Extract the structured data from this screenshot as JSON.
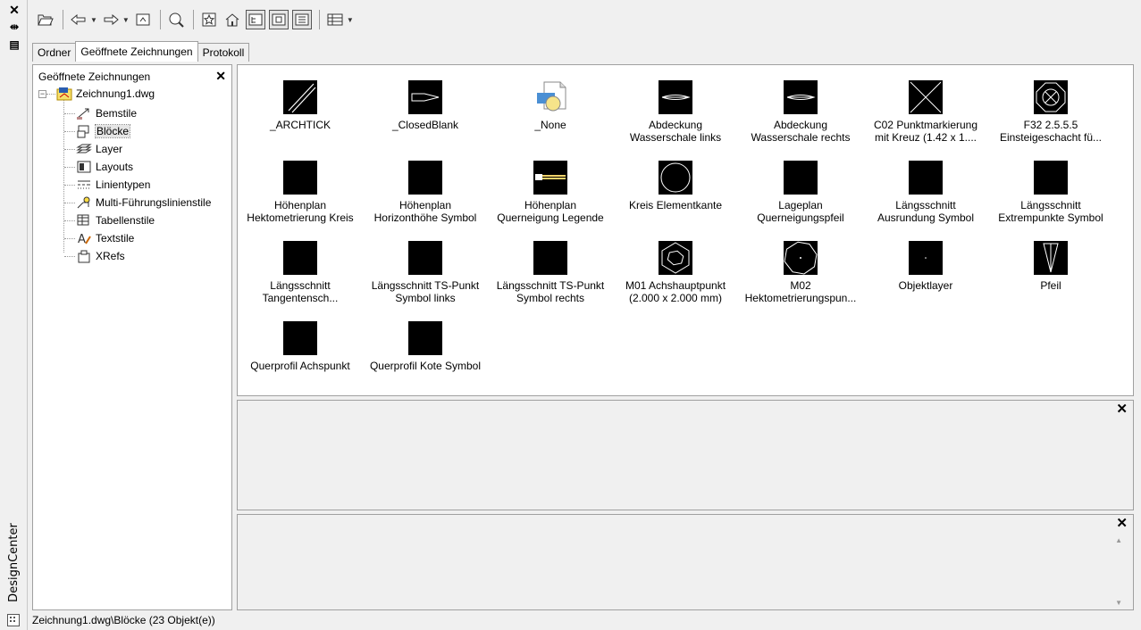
{
  "side": {
    "title": "DesignCenter",
    "close_glyph": "✕",
    "autohide_glyph": "⇹",
    "props_glyph": "▤"
  },
  "toolbar": {
    "icons": [
      "open-folder-icon",
      "back-icon",
      "forward-icon",
      "up-icon",
      "search-icon",
      "favorites-icon",
      "home-icon",
      "tree-view-toggle-icon",
      "preview-toggle-icon",
      "description-toggle-icon",
      "views-icon"
    ]
  },
  "tabs": [
    "Ordner",
    "Geöffnete Zeichnungen",
    "Protokoll"
  ],
  "active_tab": "Geöffnete Zeichnungen",
  "tree": {
    "header": "Geöffnete Zeichnungen",
    "close": "✕",
    "root": "Zeichnung1.dwg",
    "children": [
      "Bemstile",
      "Blöcke",
      "Layer",
      "Layouts",
      "Linientypen",
      "Multi-Führungslinienstile",
      "Tabellenstile",
      "Textstile",
      "XRefs"
    ],
    "selected": "Blöcke"
  },
  "blocks": [
    {
      "name": "_ARCHTICK",
      "thumb": "archtick"
    },
    {
      "name": "_ClosedBlank",
      "thumb": "closedblank"
    },
    {
      "name": "_None",
      "thumb": "none"
    },
    {
      "name": "Abdeckung\nWasserschale links",
      "thumb": "lens"
    },
    {
      "name": "Abdeckung\nWasserschale rechts",
      "thumb": "lens"
    },
    {
      "name": "C02 Punktmarkierung\nmit Kreuz (1.42 x 1....",
      "thumb": "cross"
    },
    {
      "name": "F32  2.5.5.5\nEinsteigeschacht fü...",
      "thumb": "octcross"
    },
    {
      "name": "Höhenplan\nHektometrierung Kreis",
      "thumb": "blank"
    },
    {
      "name": "Höhenplan\nHorizonthöhe Symbol",
      "thumb": "blank"
    },
    {
      "name": "Höhenplan\nQuerneigung Legende",
      "thumb": "legend"
    },
    {
      "name": "Kreis Elementkante",
      "thumb": "circle"
    },
    {
      "name": "Lageplan\nQuerneigungspfeil",
      "thumb": "blank"
    },
    {
      "name": "Längsschnitt\nAusrundung Symbol",
      "thumb": "blank"
    },
    {
      "name": "Längsschnitt\nExtrempunkte Symbol",
      "thumb": "blank"
    },
    {
      "name": "Längsschnitt\nTangentensch...",
      "thumb": "blank"
    },
    {
      "name": "Längsschnitt TS-Punkt\nSymbol links",
      "thumb": "blank"
    },
    {
      "name": "Längsschnitt TS-Punkt\nSymbol rechts",
      "thumb": "blank"
    },
    {
      "name": "M01 Achshauptpunkt\n(2.000 x 2.000 mm)",
      "thumb": "hexes"
    },
    {
      "name": "M02\nHektometrierungspun...",
      "thumb": "octagon"
    },
    {
      "name": "Objektlayer",
      "thumb": "dot"
    },
    {
      "name": "Pfeil",
      "thumb": "arrow"
    },
    {
      "name": "Querprofil Achspunkt",
      "thumb": "blank"
    },
    {
      "name": "Querprofil Kote Symbol",
      "thumb": "blank"
    }
  ],
  "preview_close": "✕",
  "description_close": "✕",
  "status": "Zeichnung1.dwg\\Blöcke (23 Objekt(e))"
}
